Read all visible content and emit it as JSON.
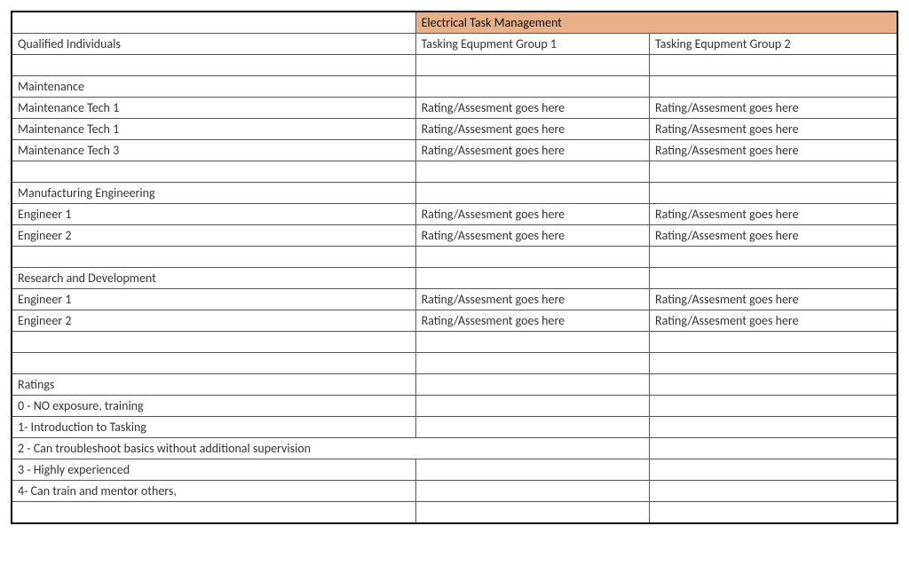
{
  "header": {
    "mainTitle": "Electrical Task Management",
    "leftHeader": "Qualified Individuals",
    "group1": "Tasking Equpment Group 1",
    "group2": "Tasking Equpment Group 2"
  },
  "sections": {
    "maintenance": {
      "title": "Maintenance",
      "rows": [
        {
          "name": "Maintenance Tech 1",
          "g1": "Rating/Assesment goes here",
          "g2": "Rating/Assesment goes here"
        },
        {
          "name": "Maintenance Tech 1",
          "g1": "Rating/Assesment goes here",
          "g2": "Rating/Assesment goes here"
        },
        {
          "name": "Maintenance Tech 3",
          "g1": "Rating/Assesment goes here",
          "g2": "Rating/Assesment goes here"
        }
      ]
    },
    "mfgEng": {
      "title": "Manufacturing Engineering",
      "rows": [
        {
          "name": "Engineer 1",
          "g1": "Rating/Assesment goes here",
          "g2": "Rating/Assesment goes here"
        },
        {
          "name": "Engineer 2",
          "g1": "Rating/Assesment goes here",
          "g2": "Rating/Assesment goes here"
        }
      ]
    },
    "rnd": {
      "title": "Research and Development",
      "rows": [
        {
          "name": "Engineer 1",
          "g1": "Rating/Assesment goes here",
          "g2": "Rating/Assesment goes here"
        },
        {
          "name": "Engineer 2",
          "g1": "Rating/Assesment goes here",
          "g2": "Rating/Assesment goes here"
        }
      ]
    }
  },
  "ratings": {
    "title": "Ratings",
    "lines": {
      "r0": "0 - NO exposure, training",
      "r1": "1- Introduction to Tasking",
      "r2": "2 - Can troubleshoot basics without additional supervision",
      "r3": "3 - Highly experienced",
      "r4": "4- Can train and mentor others,"
    }
  },
  "chart_data": {
    "type": "table",
    "title": "Electrical Task Management",
    "columns": [
      "Qualified Individuals",
      "Tasking Equpment Group 1",
      "Tasking Equpment Group 2"
    ],
    "groups": [
      {
        "name": "Maintenance",
        "rows": [
          [
            "Maintenance Tech 1",
            "Rating/Assesment goes here",
            "Rating/Assesment goes here"
          ],
          [
            "Maintenance Tech 1",
            "Rating/Assesment goes here",
            "Rating/Assesment goes here"
          ],
          [
            "Maintenance Tech 3",
            "Rating/Assesment goes here",
            "Rating/Assesment goes here"
          ]
        ]
      },
      {
        "name": "Manufacturing Engineering",
        "rows": [
          [
            "Engineer 1",
            "Rating/Assesment goes here",
            "Rating/Assesment goes here"
          ],
          [
            "Engineer 2",
            "Rating/Assesment goes here",
            "Rating/Assesment goes here"
          ]
        ]
      },
      {
        "name": "Research and Development",
        "rows": [
          [
            "Engineer 1",
            "Rating/Assesment goes here",
            "Rating/Assesment goes here"
          ],
          [
            "Engineer 2",
            "Rating/Assesment goes here",
            "Rating/Assesment goes here"
          ]
        ]
      }
    ],
    "ratings_legend": [
      "0 - NO exposure, training",
      "1- Introduction to Tasking",
      "2 - Can troubleshoot basics without additional supervision",
      "3 - Highly experienced",
      "4- Can train and mentor others,"
    ]
  }
}
